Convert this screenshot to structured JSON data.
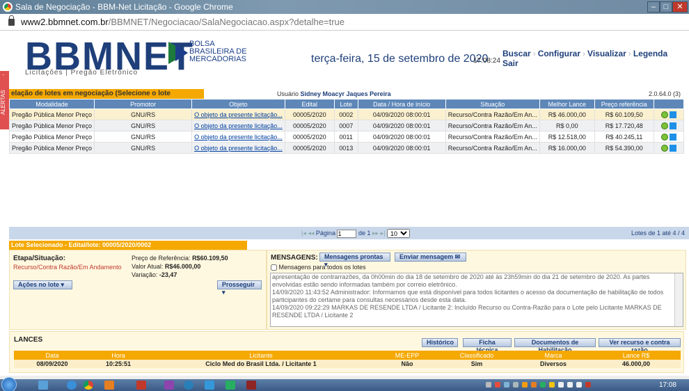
{
  "window": {
    "title": "Sala de Negociação - BBM-Net Licitação - Google Chrome",
    "minimize": "–",
    "maximize": "□",
    "close": "✕"
  },
  "address": {
    "host": "www2.bbmnet.com.br",
    "path": "/BBMNET/Negociacao/SalaNegociacao.aspx?detalhe=true"
  },
  "header": {
    "logo": "BBMNET",
    "logo_sub": "Licitações | Pregão Eletrônico",
    "bolsa_lines": [
      "BOLSA",
      "BRASILEIRA DE",
      "MERCADORIAS"
    ],
    "date": "terça-feira, 15 de setembro de 2020",
    "time": "17:08:24",
    "menu": [
      "Buscar",
      "Configurar",
      "Visualizar",
      "Legenda",
      "Sair"
    ]
  },
  "alerts": {
    "label": "ALERTAS",
    "arrow": ">"
  },
  "lots_section": {
    "title": "elação de lotes em negociação (Selecione o lote desejado):",
    "user_label": "Usuário",
    "user_name": "Sidney Moacyr Jaques Pereira",
    "version": "2.0.64.0 (3)",
    "columns": [
      "Modalidade",
      "Promotor",
      "Objeto",
      "Edital",
      "Lote",
      "Data / Hora de início",
      "Situação",
      "Melhor Lance",
      "Preço referência",
      ""
    ],
    "rows": [
      [
        "Pregão Pública Menor Preço",
        "GNU/RS",
        "O objeto da presente licitação...",
        "00005/2020",
        "0002",
        "04/09/2020 08:00:01",
        "Recurso/Contra Razão/Em An...",
        "R$ 46.000,00",
        "R$ 60.109,50"
      ],
      [
        "Pregão Pública Menor Preço",
        "GNU/RS",
        "O objeto da presente licitação...",
        "00005/2020",
        "0007",
        "04/09/2020 08:00:01",
        "Recurso/Contra Razão/Em An...",
        "R$ 0,00",
        "R$ 17.720,48"
      ],
      [
        "Pregão Pública Menor Preço",
        "GNU/RS",
        "O objeto da presente licitação...",
        "00005/2020",
        "0011",
        "04/09/2020 08:00:01",
        "Recurso/Contra Razão/Em An...",
        "R$ 12.518,00",
        "R$ 40.245,11"
      ],
      [
        "Pregão Pública Menor Preço",
        "GNU/RS",
        "O objeto da presente licitação...",
        "00005/2020",
        "0013",
        "04/09/2020 08:00:01",
        "Recurso/Contra Razão/Em An...",
        "R$ 16.000,00",
        "R$ 54.390,00"
      ]
    ]
  },
  "pager": {
    "nav_first": "|◂ ◂◂",
    "page_label": "Página",
    "page_value": "1",
    "of_label": "de 1",
    "nav_last": "▸▸ ▸|",
    "per_page": "10",
    "summary": "Lotes de 1 até 4 / 4"
  },
  "selected_lot": {
    "tab": "Lote Selecionado - Edital/lote: 00005/2020/0002",
    "stage_label": "Etapa/Situação:",
    "stage_value": "Recurso/Contra Razão/Em Andamento",
    "ref_label": "Preço de Referência:",
    "ref_value": "R$60.109,50",
    "current_label": "Valor Atual:",
    "current_value": "R$46.000,00",
    "var_label": "Variação:",
    "var_value": "-23,47",
    "actions_btn": "Ações no lote",
    "proceed_btn": "Prosseguir"
  },
  "messages": {
    "label": "MENSAGENS:",
    "ready_btn": "Mensagens prontas",
    "send_btn": "Enviar mensagem",
    "all_lots": "Mensagens para todos os lotes",
    "lines": [
      "apresentação de contrarrazões, da 0h00min do dia 18 de setembro de 2020 até às 23h59min do dia 21 de setembro de 2020. As partes",
      "envolvidas estão sendo informadas também por correio eletrônico.",
      "14/09/2020 11:43:52 Administrador: Informamos que está disponível para todos licitantes o acesso da documentação de habilitação de todos",
      "participantes do certame para consultas necessários desde esta data.",
      "14/09/2020 09:22:29 MARKAS DE RESENDE LTDA / Licitante 2: Incluído Recurso ou Contra-Razão para o Lote pelo Licitante MARKAS DE",
      "RESENDE LTDA / Licitante 2"
    ]
  },
  "lances": {
    "title": "LANCES",
    "buttons": [
      "Histórico",
      "Ficha técnica",
      "Documentos de Habilitação",
      "Ver recurso e contra razão"
    ],
    "columns": [
      "Data",
      "Hora",
      "Licitante",
      "ME-EPP",
      "Classificado",
      "Marca",
      "Lance R$"
    ],
    "row": [
      "08/09/2020",
      "10:25:51",
      "Ciclo Med do Brasil Ltda. / Licitante 1",
      "Não",
      "Sim",
      "Diversos",
      "46.000,00"
    ]
  },
  "taskbar": {
    "clock": "17:08"
  }
}
